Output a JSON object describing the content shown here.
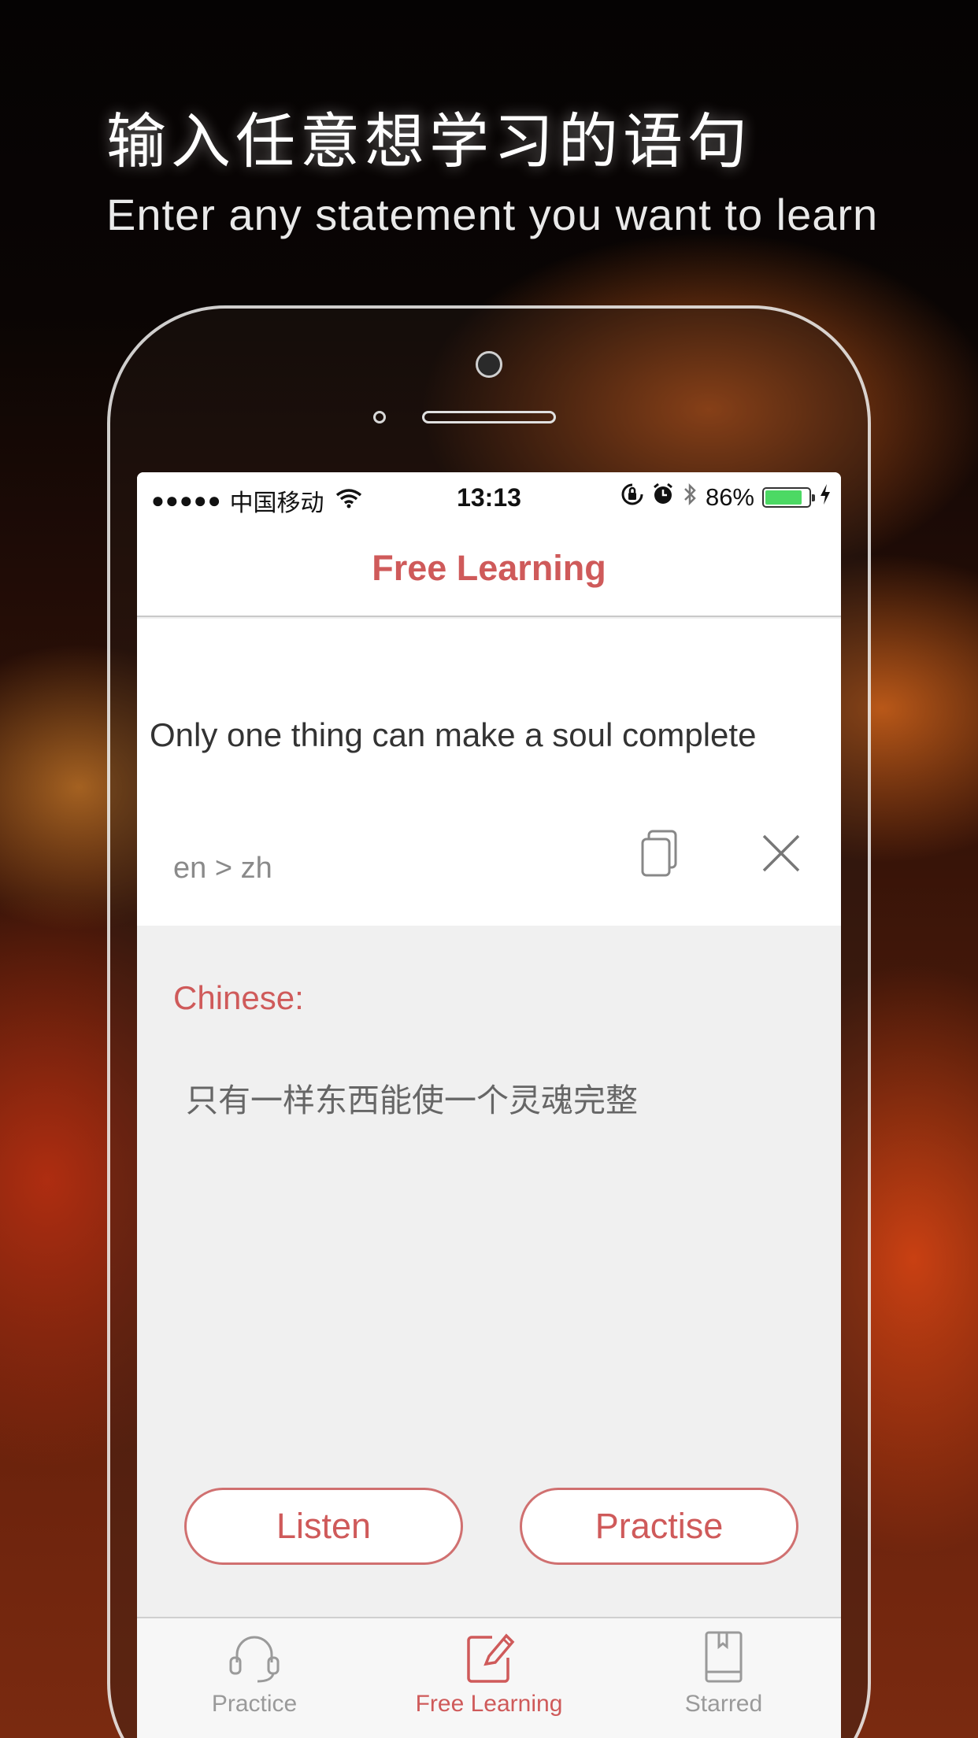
{
  "promo": {
    "headline_zh": "输入任意想学习的语句",
    "headline_en": "Enter any statement you want to learn"
  },
  "status_bar": {
    "signal_dots": "●●●●●",
    "carrier": "中国移动",
    "time": "13:13",
    "battery_percent": "86%",
    "battery_level": 0.86
  },
  "nav": {
    "title": "Free Learning"
  },
  "input": {
    "text": "Only one thing can make a soul complete",
    "language_pair": "en > zh"
  },
  "result": {
    "label": "Chinese:",
    "text": "只有一样东西能使一个灵魂完整"
  },
  "actions": {
    "listen_label": "Listen",
    "practise_label": "Practise"
  },
  "tabs": [
    {
      "label": "Practice",
      "icon": "headphones-icon",
      "active": false
    },
    {
      "label": "Free Learning",
      "icon": "edit-icon",
      "active": true
    },
    {
      "label": "Starred",
      "icon": "book-icon",
      "active": false
    }
  ],
  "colors": {
    "accent": "#cf5a5a",
    "battery": "#4cd964"
  }
}
